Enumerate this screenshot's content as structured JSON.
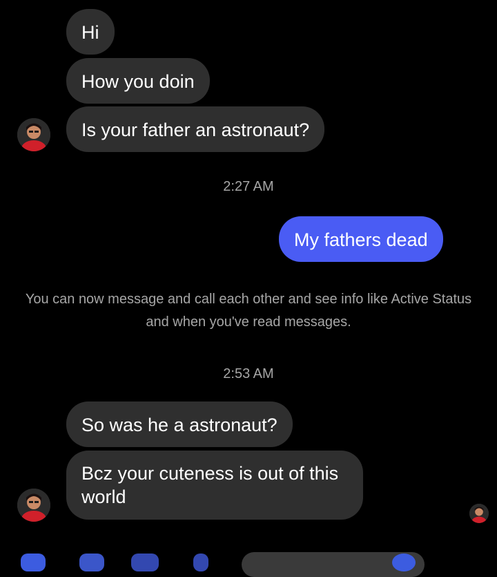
{
  "colors": {
    "background": "#000000",
    "incoming_bubble": "#2f2f2f",
    "outgoing_bubble": "#4a5cf4",
    "timestamp_text": "#a6a6a6",
    "accent": "#3c5ce0"
  },
  "conversation": {
    "incoming_group_1": [
      "Hi",
      "How you doin",
      "Is your father an astronaut?"
    ],
    "timestamp_1": "2:27 AM",
    "outgoing_message": "My fathers dead",
    "system_note": "You can now message and call each other and see info like Active Status and when you've read messages.",
    "timestamp_2": "2:53 AM",
    "incoming_group_2": [
      "So was he a astronaut?",
      "Bcz your cuteness is out of this world"
    ]
  },
  "icons": {
    "sender_avatar": "profile-photo",
    "read_receipt_avatar": "profile-photo",
    "composer_icons": [
      "camera-icon",
      "photo-icon",
      "mic-icon",
      "like-icon"
    ]
  }
}
